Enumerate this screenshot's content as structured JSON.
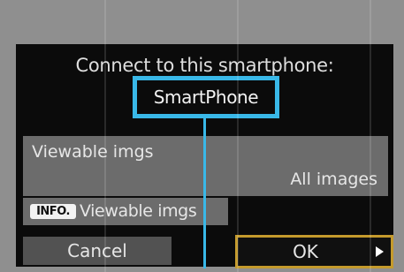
{
  "dialog": {
    "title": "Connect to this smartphone:",
    "device_name": "SmartPhone"
  },
  "viewable_setting": {
    "label": "Viewable imgs",
    "value": "All images"
  },
  "info_hint": {
    "key_label": "INFO.",
    "label": "Viewable imgs"
  },
  "buttons": {
    "cancel_label": "Cancel",
    "ok_label": "OK"
  },
  "icons": {
    "ok_arrow": "right-triangle-icon"
  },
  "colors": {
    "highlight": "#39b8e8",
    "selection": "#c49a2c",
    "dialog_background": "#0b0b0b",
    "row_background": "#6c6c6c"
  }
}
